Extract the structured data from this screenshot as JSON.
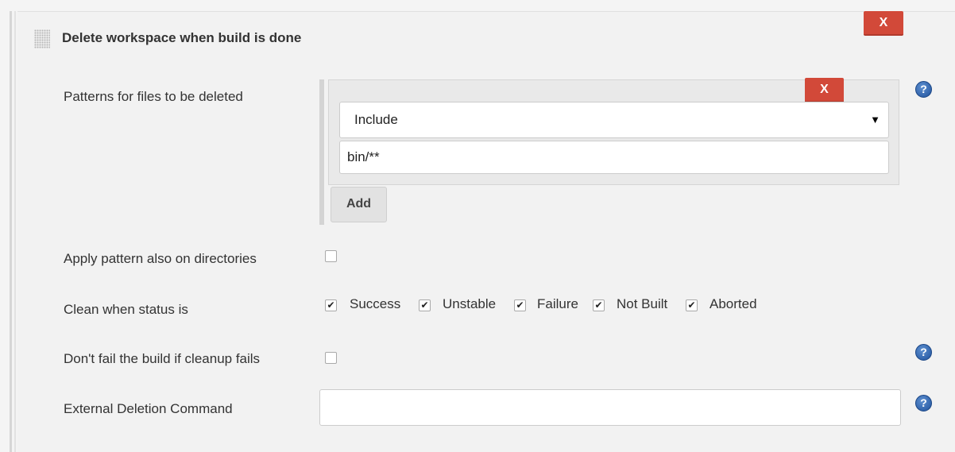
{
  "section": {
    "title": "Delete workspace when build is done",
    "delete_label": "X"
  },
  "patterns": {
    "label": "Patterns for files to be deleted",
    "delete_label": "X",
    "type_selected": "Include",
    "pattern_value": "bin/**",
    "add_label": "Add"
  },
  "apply_dirs": {
    "label": "Apply pattern also on directories",
    "checked": false
  },
  "clean_status": {
    "label": "Clean when status is",
    "options": [
      {
        "label": "Success",
        "checked": true
      },
      {
        "label": "Unstable",
        "checked": true
      },
      {
        "label": "Failure",
        "checked": true
      },
      {
        "label": "Not Built",
        "checked": true
      },
      {
        "label": "Aborted",
        "checked": true
      }
    ]
  },
  "no_fail": {
    "label": "Don't fail the build if cleanup fails",
    "checked": false
  },
  "external": {
    "label": "External Deletion Command",
    "value": ""
  },
  "icons": {
    "help": "help-icon",
    "drag": "drag-handle-icon",
    "dropdown": "dropdown-arrow-icon"
  },
  "colors": {
    "delete_button": "#d24939",
    "help_icon": "#2a5ca8",
    "background": "#f2f2f2"
  }
}
